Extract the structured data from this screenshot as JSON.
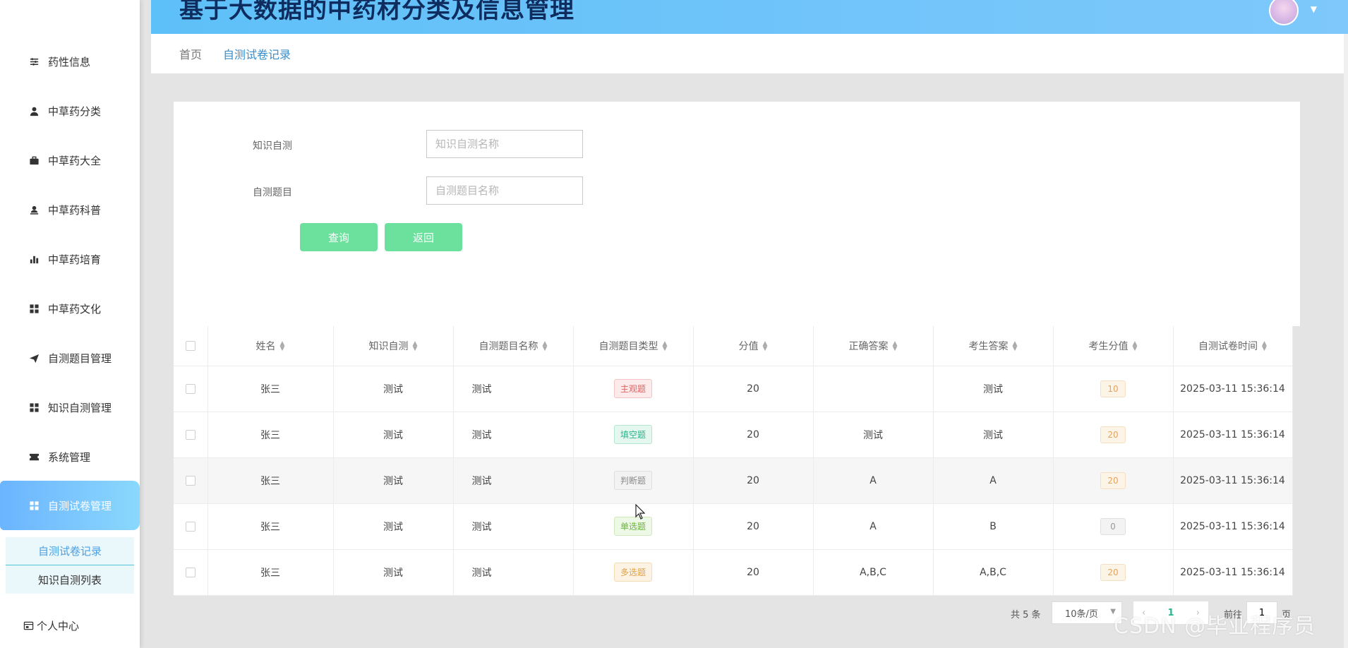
{
  "app": {
    "title": "基于大数据的中药材分类及信息管理"
  },
  "sidebar": {
    "items": [
      {
        "label": "药性信息",
        "icon": "sliders-icon"
      },
      {
        "label": "中草药分类",
        "icon": "user-icon"
      },
      {
        "label": "中草药大全",
        "icon": "briefcase-icon"
      },
      {
        "label": "中草药科普",
        "icon": "user-id-icon"
      },
      {
        "label": "中草药培育",
        "icon": "bar-chart-icon"
      },
      {
        "label": "中草药文化",
        "icon": "grid-icon"
      },
      {
        "label": "自测题目管理",
        "icon": "send-icon"
      },
      {
        "label": "知识自测管理",
        "icon": "grid-icon"
      },
      {
        "label": "系统管理",
        "icon": "ticket-icon"
      },
      {
        "label": "自测试卷管理",
        "icon": "grid-icon"
      }
    ],
    "submenu": [
      {
        "label": "自测试卷记录"
      },
      {
        "label": "知识自测列表"
      }
    ],
    "profile": {
      "label": "个人中心",
      "icon": "profile-icon"
    }
  },
  "breadcrumb": {
    "home": "首页",
    "current": "自测试卷记录"
  },
  "search": {
    "knowledge_label": "知识自测",
    "knowledge_placeholder": "知识自测名称",
    "question_label": "自测题目",
    "question_placeholder": "自测题目名称",
    "query_button": "查询",
    "back_button": "返回"
  },
  "table": {
    "headers": [
      "姓名",
      "知识自测",
      "自测题目名称",
      "自测题目类型",
      "分值",
      "正确答案",
      "考生答案",
      "考生分值",
      "自测试卷时间"
    ],
    "rows": [
      {
        "name": "张三",
        "knowledge": "测试",
        "question": "测试",
        "type": "主观题",
        "type_color": "red",
        "score": "20",
        "correct": "",
        "answer": "测试",
        "got": "10",
        "got_color": "orange",
        "time": "2025-03-11 15:36:14"
      },
      {
        "name": "张三",
        "knowledge": "测试",
        "question": "测试",
        "type": "填空题",
        "type_color": "teal",
        "score": "20",
        "correct": "测试",
        "answer": "测试",
        "got": "20",
        "got_color": "orange",
        "time": "2025-03-11 15:36:14"
      },
      {
        "name": "张三",
        "knowledge": "测试",
        "question": "测试",
        "type": "判断题",
        "type_color": "gray",
        "score": "20",
        "correct": "A",
        "answer": "A",
        "got": "20",
        "got_color": "orange",
        "time": "2025-03-11 15:36:14"
      },
      {
        "name": "张三",
        "knowledge": "测试",
        "question": "测试",
        "type": "单选题",
        "type_color": "green",
        "score": "20",
        "correct": "A",
        "answer": "B",
        "got": "0",
        "got_color": "gray",
        "time": "2025-03-11 15:36:14"
      },
      {
        "name": "张三",
        "knowledge": "测试",
        "question": "测试",
        "type": "多选题",
        "type_color": "orange",
        "score": "20",
        "correct": "A,B,C",
        "answer": "A,B,C",
        "got": "20",
        "got_color": "orange",
        "time": "2025-03-11 15:36:14"
      }
    ]
  },
  "pagination": {
    "total": "共 5 条",
    "page_size": "10条/页",
    "current_page": "1",
    "goto_label": "前往",
    "goto_value": "1",
    "goto_suffix": "页"
  },
  "watermark": "CSDN @毕业程序员"
}
